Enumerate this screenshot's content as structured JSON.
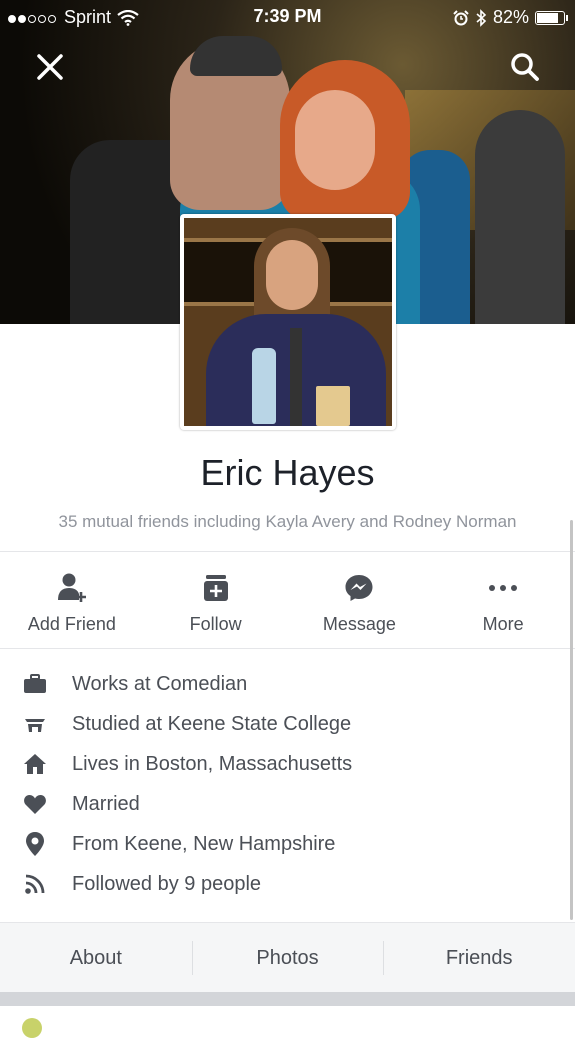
{
  "status_bar": {
    "carrier": "Sprint",
    "time": "7:39 PM",
    "battery": "82%",
    "battery_level": 0.82
  },
  "profile": {
    "name": "Eric Hayes",
    "mutual_friends": "35 mutual friends including Kayla Avery and Rodney Norman"
  },
  "actions": [
    {
      "label": "Add Friend",
      "icon": "add-friend-icon"
    },
    {
      "label": "Follow",
      "icon": "follow-icon"
    },
    {
      "label": "Message",
      "icon": "messenger-icon"
    },
    {
      "label": "More",
      "icon": "more-icon"
    }
  ],
  "details": [
    {
      "text": "Works at Comedian",
      "icon": "briefcase-icon"
    },
    {
      "text": "Studied at Keene State College",
      "icon": "graduation-cap-icon"
    },
    {
      "text": "Lives in Boston, Massachusetts",
      "icon": "home-icon"
    },
    {
      "text": "Married",
      "icon": "heart-icon"
    },
    {
      "text": "From Keene, New Hampshire",
      "icon": "location-pin-icon"
    },
    {
      "text": "Followed by 9 people",
      "icon": "rss-icon"
    }
  ],
  "tabs": [
    {
      "label": "About"
    },
    {
      "label": "Photos"
    },
    {
      "label": "Friends"
    }
  ],
  "colors": {
    "text_primary": "#1d2129",
    "text_secondary": "#4b4f56",
    "text_muted": "#90949c",
    "tab_background": "#f5f6f7"
  }
}
